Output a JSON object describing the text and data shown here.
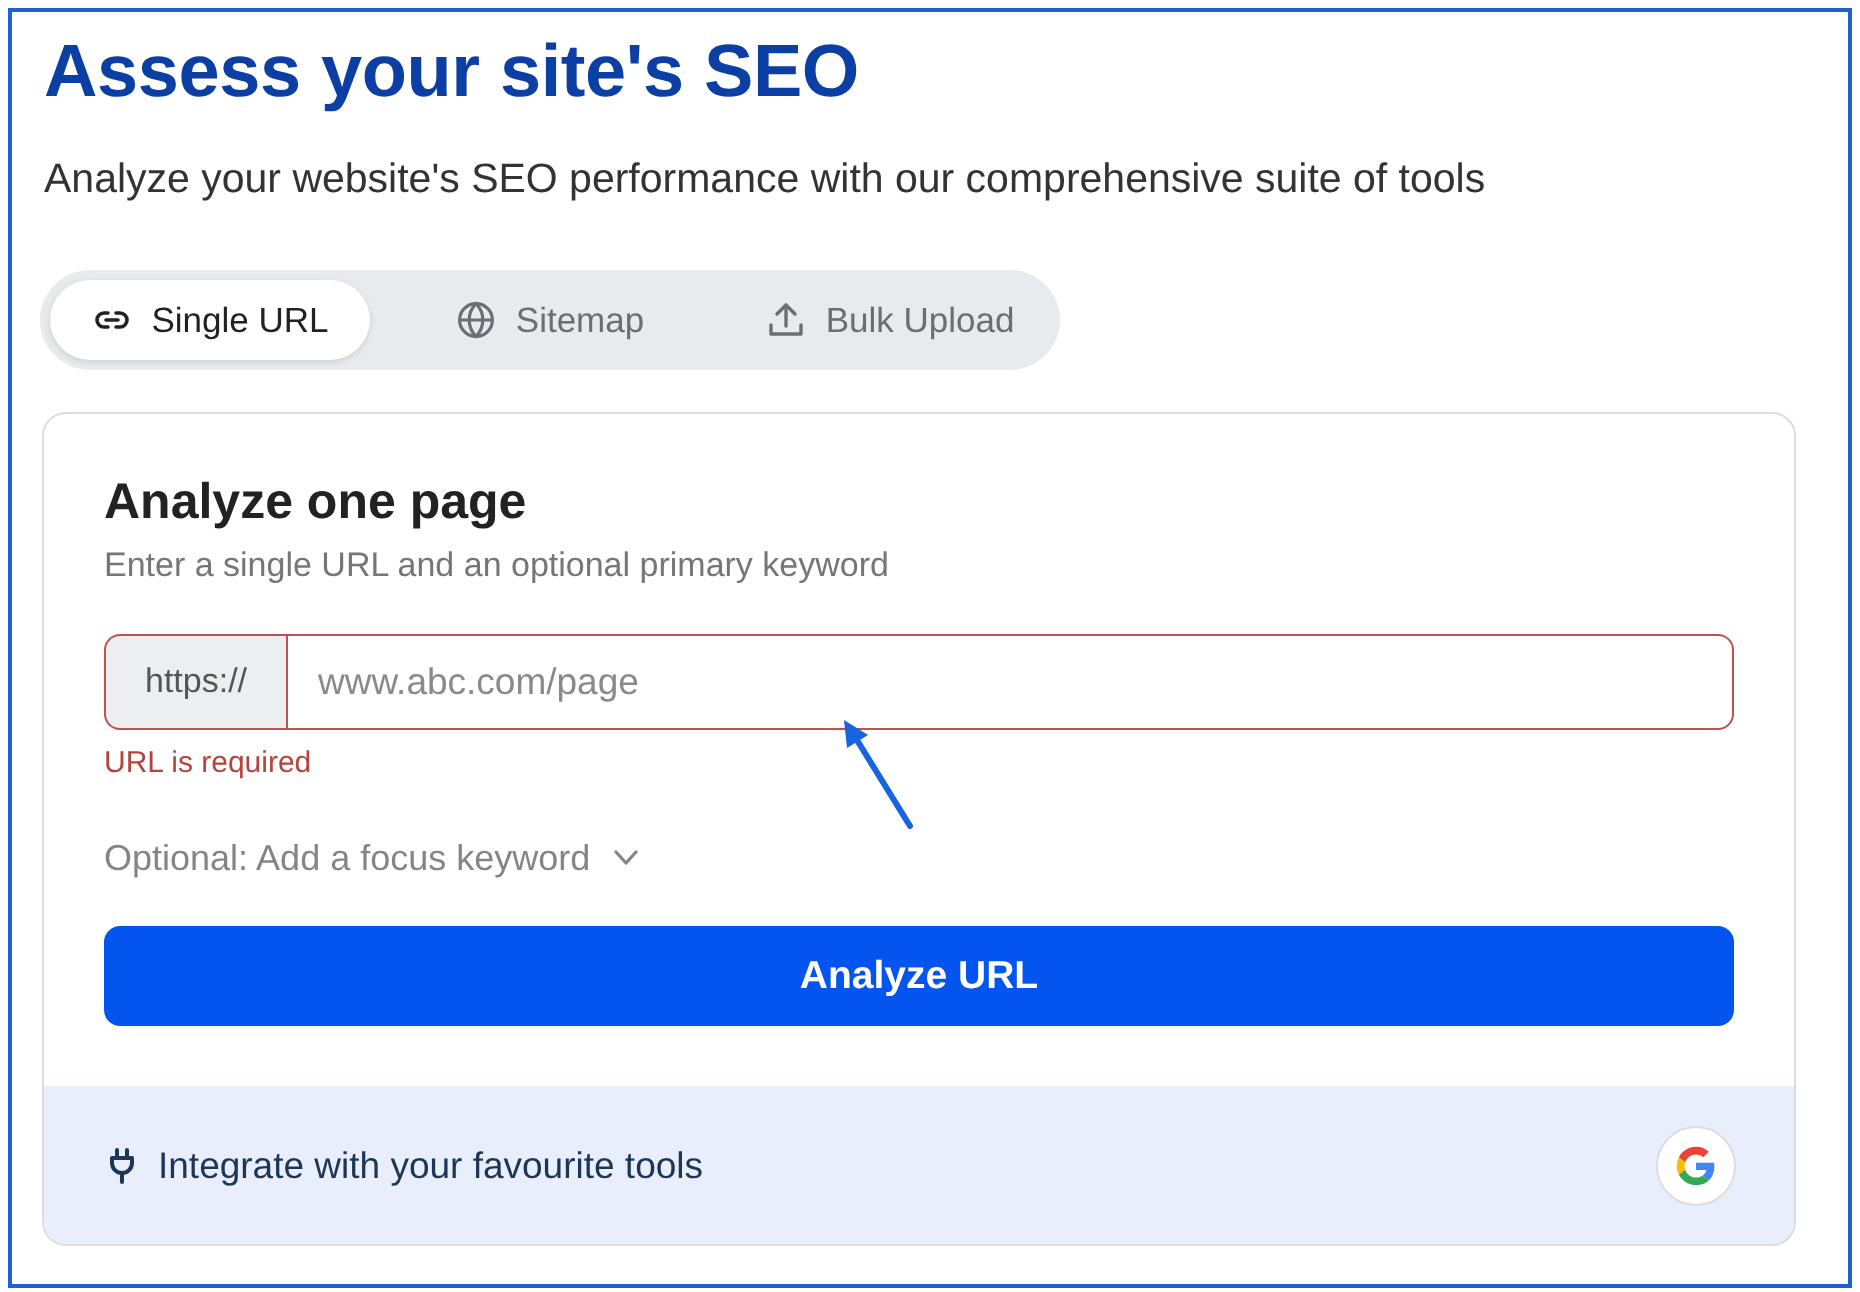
{
  "header": {
    "title": "Assess your site's SEO",
    "subtitle": "Analyze your website's SEO performance with our comprehensive suite of tools"
  },
  "tabs": [
    {
      "label": "Single URL",
      "selected": true
    },
    {
      "label": "Sitemap",
      "selected": false
    },
    {
      "label": "Bulk Upload",
      "selected": false
    }
  ],
  "card": {
    "heading": "Analyze one page",
    "description": "Enter a single URL and an optional primary keyword",
    "url_field": {
      "prefix": "https://",
      "placeholder": "www.abc.com/page",
      "invalid": true,
      "error": "URL is required"
    },
    "keyword_toggle": {
      "label": "Optional: Add a focus keyword",
      "expanded": false
    },
    "submit_button": "Analyze URL",
    "footer": {
      "text": "Integrate with your favourite tools"
    }
  }
}
